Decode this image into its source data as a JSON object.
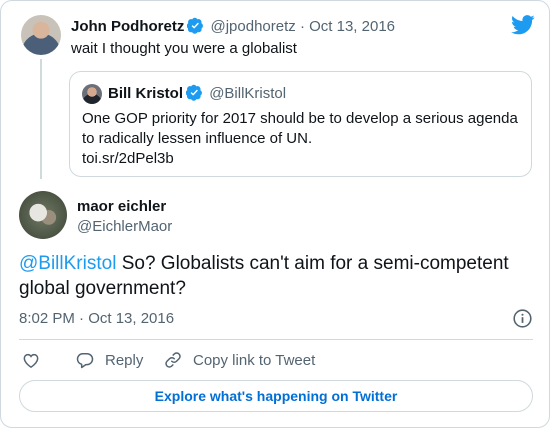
{
  "parent_tweet": {
    "author_name": "John Podhoretz",
    "handle": "@jpodhoretz",
    "separator": "·",
    "date": "Oct 13, 2016",
    "text": "wait I thought you were a globalist"
  },
  "quoted_tweet": {
    "author_name": "Bill Kristol",
    "handle": "@BillKristol",
    "text": "One GOP priority for 2017 should be to develop a serious agenda to radically lessen influence of UN.",
    "link": "toi.sr/2dPel3b"
  },
  "main_tweet": {
    "author_name": "maor eichler",
    "handle": "@EichlerMaor",
    "mention": "@BillKristol",
    "text": " So? Globalists can't aim for a semi-competent global government?",
    "timestamp": "8:02 PM · Oct 13, 2016"
  },
  "actions": {
    "reply_label": "Reply",
    "copy_label": "Copy link to Tweet"
  },
  "explore_label": "Explore what's happening on Twitter",
  "colors": {
    "accent": "#1d9bf0",
    "link": "#006fd6",
    "muted_text": "#536471",
    "border": "#cfd9de"
  },
  "icons": [
    "twitter-bird-icon",
    "verified-badge-icon",
    "info-icon",
    "heart-icon",
    "reply-icon",
    "link-icon"
  ]
}
